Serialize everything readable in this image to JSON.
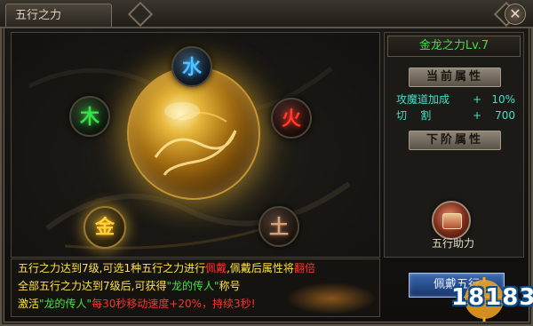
{
  "window": {
    "title": "五行之力",
    "close_label": "✕"
  },
  "elements": {
    "water": "水",
    "wood": "木",
    "fire": "火",
    "metal": "金",
    "earth": "土"
  },
  "side": {
    "level_title": "金龙之力Lv.7",
    "current_header": "当前属性",
    "next_header": "下阶属性",
    "attributes": [
      {
        "name": "攻魔道加成",
        "plus": "+",
        "value": "10%"
      },
      {
        "name": "切    割",
        "plus": "+",
        "value": "700"
      }
    ],
    "assist_label": "五行助力",
    "equip_label": "佩戴五行"
  },
  "description": {
    "line1": {
      "a": "五行之力达到7级,可选1种五行之力进行",
      "b": "佩戴",
      "c": ",佩戴后属性将",
      "d": "翻倍"
    },
    "line2": {
      "a": "全部五行之力达到7级后,可获得",
      "b": "\"龙的传人\"",
      "c": "称号"
    },
    "line3": {
      "a": "激活",
      "b": "\"龙的传人\"",
      "c": "每30秒移动速度+20%，持续3秒!"
    }
  },
  "watermark": "18183",
  "colors": {
    "accent_green": "#3ee04a",
    "attr_cyan": "#3fe0c8",
    "desc_yellow": "#ffe14a",
    "highlight_red": "#ff3030"
  }
}
